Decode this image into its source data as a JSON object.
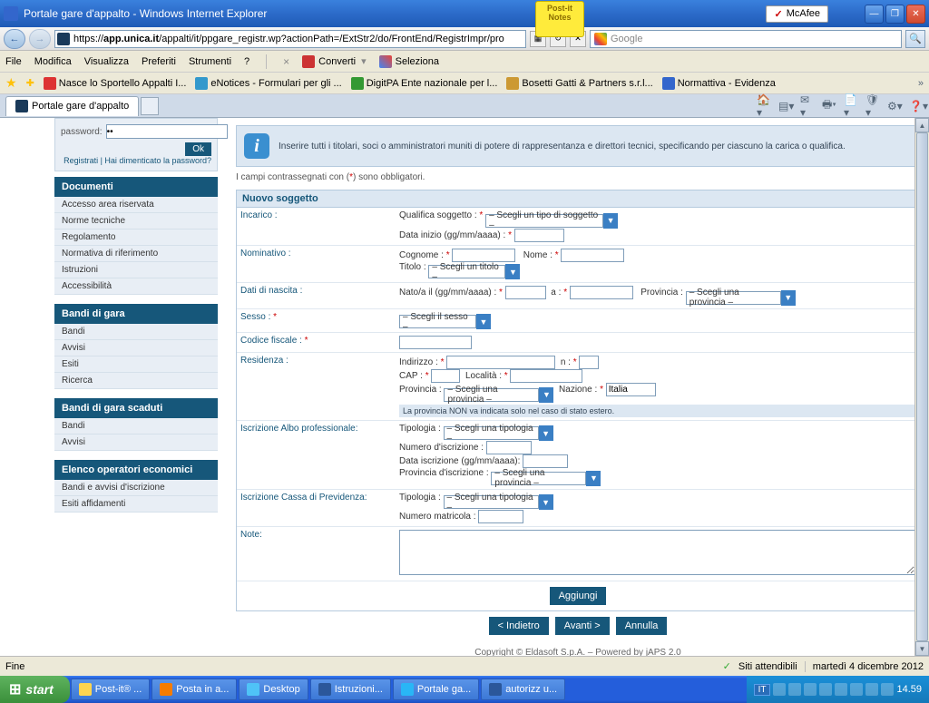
{
  "window": {
    "title": "Portale gare d'appalto - Windows Internet Explorer",
    "mcafee": "McAfee",
    "postit": "Post-it Notes"
  },
  "address": {
    "url_host": "app.unica.it",
    "url_prefix": "https://",
    "url_path": "/appalti/it/ppgare_registr.wp?actionPath=/ExtStr2/do/FrontEnd/RegistrImpr/pro",
    "search_placeholder": "Google"
  },
  "menu": {
    "file": "File",
    "modifica": "Modifica",
    "visualizza": "Visualizza",
    "preferiti": "Preferiti",
    "strumenti": "Strumenti",
    "help": "?",
    "converti": "Converti",
    "seleziona": "Seleziona"
  },
  "bookmarks": [
    "Nasce lo Sportello Appalti I...",
    "eNotices - Formulari per gli ...",
    "DigitPA  Ente nazionale per l...",
    "Bosetti Gatti & Partners s.r.l...",
    "Normattiva - Evidenza"
  ],
  "tab": "Portale gare d'appalto",
  "login": {
    "password_label": "password:",
    "ok": "Ok",
    "links": "Registrati | Hai dimenticato la password?"
  },
  "sidebar": [
    {
      "head": "Documenti",
      "items": [
        "Accesso area riservata",
        "Norme tecniche",
        "Regolamento",
        "Normativa di riferimento",
        "Istruzioni",
        "Accessibilità"
      ]
    },
    {
      "head": "Bandi di gara",
      "items": [
        "Bandi",
        "Avvisi",
        "Esiti",
        "Ricerca"
      ]
    },
    {
      "head": "Bandi di gara scaduti",
      "items": [
        "Bandi",
        "Avvisi"
      ]
    },
    {
      "head": "Elenco operatori economici",
      "items": [
        "Bandi e avvisi d'iscrizione",
        "Esiti affidamenti"
      ]
    }
  ],
  "info": "Inserire tutti i titolari, soci o amministratori muniti di potere di rappresentanza e direttori tecnici, specificando per ciascuno la carica o qualifica.",
  "mandatory_prefix": "I campi contrassegnati con (",
  "mandatory_suffix": ") sono obbligatori.",
  "form": {
    "heading": "Nuovo soggetto",
    "rows": {
      "incarico": "Incarico :",
      "nominativo": "Nominativo :",
      "dati_nascita": "Dati di nascita :",
      "sesso": "Sesso : ",
      "cf": "Codice fiscale : ",
      "residenza": "Residenza :",
      "albo": "Iscrizione Albo professionale:",
      "cassa": "Iscrizione Cassa di Previdenza:",
      "note": "Note:"
    },
    "labels": {
      "qualifica": "Qualifica soggetto : ",
      "data_inizio": "Data inizio (gg/mm/aaaa) : ",
      "cognome": "Cognome : ",
      "nome": "Nome : ",
      "titolo": "Titolo : ",
      "nato": "Nato/a il (gg/mm/aaaa) : ",
      "a": "a : ",
      "provincia": "Provincia : ",
      "indirizzo": "Indirizzo : ",
      "n": "n : ",
      "cap": "CAP : ",
      "localita": "Località : ",
      "nazione": "Nazione : ",
      "tipologia": "Tipologia : ",
      "num_iscr": "Numero d'iscrizione : ",
      "data_iscr": "Data iscrizione (gg/mm/aaaa):",
      "prov_iscr": "Provincia d'iscrizione : ",
      "num_matr": "Numero matricola : "
    },
    "selects": {
      "tipo_soggetto": "– Scegli un tipo di soggetto –",
      "titolo": "– Scegli un titolo –",
      "provincia": "– Scegli una provincia –",
      "sesso": "– Scegli il sesso –",
      "tipologia": "– Scegli una tipologia –",
      "nazione": "Italia"
    },
    "prov_note": "La provincia NON va indicata solo nel caso di stato estero.",
    "aggiungi": "Aggiungi",
    "indietro": "< Indietro",
    "avanti": "Avanti >",
    "annulla": "Annulla"
  },
  "footer": "Copyright © Eldasoft S.p.A. – Powered by jAPS 2.0",
  "status": {
    "fine": "Fine",
    "siti": "Siti attendibili",
    "date": "martedì 4 dicembre 2012"
  },
  "taskbar": {
    "start": "start",
    "items": [
      "Post-it® ...",
      "Posta in a...",
      "Desktop",
      "Istruzioni...",
      "Portale ga...",
      "autorizz u..."
    ],
    "lang": "IT",
    "clock": "14.59"
  }
}
